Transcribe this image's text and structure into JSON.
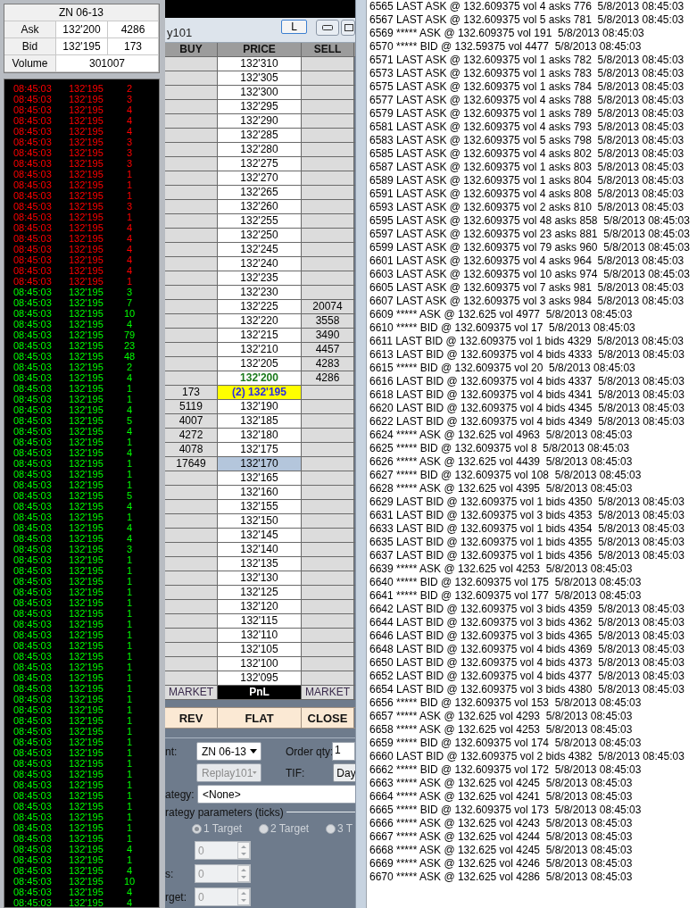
{
  "quote": {
    "title": "ZN 06-13",
    "rows": [
      {
        "label": "Ask",
        "price": "132'200",
        "size": "4286"
      },
      {
        "label": "Bid",
        "price": "132'195",
        "size": "173"
      }
    ],
    "volume_label": "Volume",
    "volume": "301007"
  },
  "tape": [
    {
      "time": "08:45:03",
      "price": "132'195",
      "qty": "2",
      "color": "#ff0000"
    },
    {
      "time": "08:45:03",
      "price": "132'195",
      "qty": "3",
      "color": "#ff0000"
    },
    {
      "time": "08:45:03",
      "price": "132'195",
      "qty": "4",
      "color": "#ff0000"
    },
    {
      "time": "08:45:03",
      "price": "132'195",
      "qty": "4",
      "color": "#ff0000"
    },
    {
      "time": "08:45:03",
      "price": "132'195",
      "qty": "4",
      "color": "#ff0000"
    },
    {
      "time": "08:45:03",
      "price": "132'195",
      "qty": "3",
      "color": "#ff0000"
    },
    {
      "time": "08:45:03",
      "price": "132'195",
      "qty": "3",
      "color": "#ff0000"
    },
    {
      "time": "08:45:03",
      "price": "132'195",
      "qty": "3",
      "color": "#ff0000"
    },
    {
      "time": "08:45:03",
      "price": "132'195",
      "qty": "1",
      "color": "#ff0000"
    },
    {
      "time": "08:45:03",
      "price": "132'195",
      "qty": "1",
      "color": "#ff0000"
    },
    {
      "time": "08:45:03",
      "price": "132'195",
      "qty": "1",
      "color": "#ff0000"
    },
    {
      "time": "08:45:03",
      "price": "132'195",
      "qty": "3",
      "color": "#ff0000"
    },
    {
      "time": "08:45:03",
      "price": "132'195",
      "qty": "1",
      "color": "#ff0000"
    },
    {
      "time": "08:45:03",
      "price": "132'195",
      "qty": "4",
      "color": "#ff0000"
    },
    {
      "time": "08:45:03",
      "price": "132'195",
      "qty": "4",
      "color": "#ff0000"
    },
    {
      "time": "08:45:03",
      "price": "132'195",
      "qty": "4",
      "color": "#ff0000"
    },
    {
      "time": "08:45:03",
      "price": "132'195",
      "qty": "4",
      "color": "#ff0000"
    },
    {
      "time": "08:45:03",
      "price": "132'195",
      "qty": "4",
      "color": "#ff0000"
    },
    {
      "time": "08:45:03",
      "price": "132'195",
      "qty": "1",
      "color": "#ff0000"
    },
    {
      "time": "08:45:03",
      "price": "132'195",
      "qty": "3",
      "color": "#00ff00"
    },
    {
      "time": "08:45:03",
      "price": "132'195",
      "qty": "7",
      "color": "#00ff00"
    },
    {
      "time": "08:45:03",
      "price": "132'195",
      "qty": "10",
      "color": "#00ff00"
    },
    {
      "time": "08:45:03",
      "price": "132'195",
      "qty": "4",
      "color": "#00ff00"
    },
    {
      "time": "08:45:03",
      "price": "132'195",
      "qty": "79",
      "color": "#00ff00"
    },
    {
      "time": "08:45:03",
      "price": "132'195",
      "qty": "23",
      "color": "#00ff00"
    },
    {
      "time": "08:45:03",
      "price": "132'195",
      "qty": "48",
      "color": "#00ff00"
    },
    {
      "time": "08:45:03",
      "price": "132'195",
      "qty": "2",
      "color": "#00ff00"
    },
    {
      "time": "08:45:03",
      "price": "132'195",
      "qty": "4",
      "color": "#00ff00"
    },
    {
      "time": "08:45:03",
      "price": "132'195",
      "qty": "1",
      "color": "#00ff00"
    },
    {
      "time": "08:45:03",
      "price": "132'195",
      "qty": "1",
      "color": "#00ff00"
    },
    {
      "time": "08:45:03",
      "price": "132'195",
      "qty": "4",
      "color": "#00ff00"
    },
    {
      "time": "08:45:03",
      "price": "132'195",
      "qty": "5",
      "color": "#00ff00"
    },
    {
      "time": "08:45:03",
      "price": "132'195",
      "qty": "4",
      "color": "#00ff00"
    },
    {
      "time": "08:45:03",
      "price": "132'195",
      "qty": "1",
      "color": "#00ff00"
    },
    {
      "time": "08:45:03",
      "price": "132'195",
      "qty": "4",
      "color": "#00ff00"
    },
    {
      "time": "08:45:03",
      "price": "132'195",
      "qty": "1",
      "color": "#00ff00"
    },
    {
      "time": "08:45:03",
      "price": "132'195",
      "qty": "1",
      "color": "#00ff00"
    },
    {
      "time": "08:45:03",
      "price": "132'195",
      "qty": "1",
      "color": "#00ff00"
    },
    {
      "time": "08:45:03",
      "price": "132'195",
      "qty": "5",
      "color": "#00ff00"
    },
    {
      "time": "08:45:03",
      "price": "132'195",
      "qty": "4",
      "color": "#00ff00"
    },
    {
      "time": "08:45:03",
      "price": "132'195",
      "qty": "1",
      "color": "#00ff00"
    },
    {
      "time": "08:45:03",
      "price": "132'195",
      "qty": "4",
      "color": "#00ff00"
    },
    {
      "time": "08:45:03",
      "price": "132'195",
      "qty": "4",
      "color": "#00ff00"
    },
    {
      "time": "08:45:03",
      "price": "132'195",
      "qty": "3",
      "color": "#00ff00"
    },
    {
      "time": "08:45:03",
      "price": "132'195",
      "qty": "1",
      "color": "#00ff00"
    },
    {
      "time": "08:45:03",
      "price": "132'195",
      "qty": "1",
      "color": "#00ff00"
    },
    {
      "time": "08:45:03",
      "price": "132'195",
      "qty": "1",
      "color": "#00ff00"
    },
    {
      "time": "08:45:03",
      "price": "132'195",
      "qty": "1",
      "color": "#00ff00"
    },
    {
      "time": "08:45:03",
      "price": "132'195",
      "qty": "1",
      "color": "#00ff00"
    },
    {
      "time": "08:45:03",
      "price": "132'195",
      "qty": "1",
      "color": "#00ff00"
    },
    {
      "time": "08:45:03",
      "price": "132'195",
      "qty": "1",
      "color": "#00ff00"
    },
    {
      "time": "08:45:03",
      "price": "132'195",
      "qty": "1",
      "color": "#00ff00"
    },
    {
      "time": "08:45:03",
      "price": "132'195",
      "qty": "1",
      "color": "#00ff00"
    },
    {
      "time": "08:45:03",
      "price": "132'195",
      "qty": "1",
      "color": "#00ff00"
    },
    {
      "time": "08:45:03",
      "price": "132'195",
      "qty": "1",
      "color": "#00ff00"
    },
    {
      "time": "08:45:03",
      "price": "132'195",
      "qty": "1",
      "color": "#00ff00"
    },
    {
      "time": "08:45:03",
      "price": "132'195",
      "qty": "1",
      "color": "#00ff00"
    },
    {
      "time": "08:45:03",
      "price": "132'195",
      "qty": "1",
      "color": "#00ff00"
    },
    {
      "time": "08:45:03",
      "price": "132'195",
      "qty": "1",
      "color": "#00ff00"
    },
    {
      "time": "08:45:03",
      "price": "132'195",
      "qty": "1",
      "color": "#00ff00"
    },
    {
      "time": "08:45:03",
      "price": "132'195",
      "qty": "1",
      "color": "#00ff00"
    },
    {
      "time": "08:45:03",
      "price": "132'195",
      "qty": "1",
      "color": "#00ff00"
    },
    {
      "time": "08:45:03",
      "price": "132'195",
      "qty": "1",
      "color": "#00ff00"
    },
    {
      "time": "08:45:03",
      "price": "132'195",
      "qty": "1",
      "color": "#00ff00"
    },
    {
      "time": "08:45:03",
      "price": "132'195",
      "qty": "1",
      "color": "#00ff00"
    },
    {
      "time": "08:45:03",
      "price": "132'195",
      "qty": "1",
      "color": "#00ff00"
    },
    {
      "time": "08:45:03",
      "price": "132'195",
      "qty": "1",
      "color": "#00ff00"
    },
    {
      "time": "08:45:03",
      "price": "132'195",
      "qty": "1",
      "color": "#00ff00"
    },
    {
      "time": "08:45:03",
      "price": "132'195",
      "qty": "1",
      "color": "#00ff00"
    },
    {
      "time": "08:45:03",
      "price": "132'195",
      "qty": "1",
      "color": "#00ff00"
    },
    {
      "time": "08:45:03",
      "price": "132'195",
      "qty": "1",
      "color": "#00ff00"
    },
    {
      "time": "08:45:03",
      "price": "132'195",
      "qty": "4",
      "color": "#00ff00"
    },
    {
      "time": "08:45:03",
      "price": "132'195",
      "qty": "1",
      "color": "#00ff00"
    },
    {
      "time": "08:45:03",
      "price": "132'195",
      "qty": "4",
      "color": "#00ff00"
    },
    {
      "time": "08:45:03",
      "price": "132'195",
      "qty": "10",
      "color": "#00ff00"
    },
    {
      "time": "08:45:03",
      "price": "132'195",
      "qty": "4",
      "color": "#00ff00"
    },
    {
      "time": "08:45:03",
      "price": "132'195",
      "qty": "4",
      "color": "#00ff00"
    }
  ],
  "dom": {
    "title": "y101",
    "lock_button": "L",
    "columns": [
      "BUY",
      "PRICE",
      "SELL"
    ],
    "rows": [
      {
        "price": "132'310",
        "kind": "plain"
      },
      {
        "price": "132'305",
        "kind": "plain"
      },
      {
        "price": "132'300",
        "kind": "plain"
      },
      {
        "price": "132'295",
        "kind": "plain"
      },
      {
        "price": "132'290",
        "kind": "plain"
      },
      {
        "price": "132'285",
        "kind": "plain"
      },
      {
        "price": "132'280",
        "kind": "plain"
      },
      {
        "price": "132'275",
        "kind": "plain"
      },
      {
        "price": "132'270",
        "kind": "plain"
      },
      {
        "price": "132'265",
        "kind": "plain"
      },
      {
        "price": "132'260",
        "kind": "plain"
      },
      {
        "price": "132'255",
        "kind": "plain"
      },
      {
        "price": "132'250",
        "kind": "plain"
      },
      {
        "price": "132'245",
        "kind": "plain"
      },
      {
        "price": "132'240",
        "kind": "plain"
      },
      {
        "price": "132'235",
        "kind": "plain"
      },
      {
        "price": "132'230",
        "kind": "plain"
      },
      {
        "price": "132'225",
        "sell": "20074",
        "kind": "plain"
      },
      {
        "price": "132'220",
        "sell": "3558",
        "kind": "plain"
      },
      {
        "price": "132'215",
        "sell": "3490",
        "kind": "plain"
      },
      {
        "price": "132'210",
        "sell": "4457",
        "kind": "plain"
      },
      {
        "price": "132'205",
        "sell": "4283",
        "kind": "plain"
      },
      {
        "price": "132'200",
        "sell": "4286",
        "kind": "best_ask"
      },
      {
        "buy": "173",
        "price": "(2) 132'195",
        "kind": "last"
      },
      {
        "buy": "5119",
        "price": "132'190",
        "kind": "plain"
      },
      {
        "buy": "4007",
        "price": "132'185",
        "kind": "plain"
      },
      {
        "buy": "4272",
        "price": "132'180",
        "kind": "plain"
      },
      {
        "buy": "4078",
        "price": "132'175",
        "kind": "plain"
      },
      {
        "buy": "17649",
        "price": "132'170",
        "kind": "cursor"
      },
      {
        "price": "132'165",
        "kind": "plain"
      },
      {
        "price": "132'160",
        "kind": "plain"
      },
      {
        "price": "132'155",
        "kind": "plain"
      },
      {
        "price": "132'150",
        "kind": "plain"
      },
      {
        "price": "132'145",
        "kind": "plain"
      },
      {
        "price": "132'140",
        "kind": "plain"
      },
      {
        "price": "132'135",
        "kind": "plain"
      },
      {
        "price": "132'130",
        "kind": "plain"
      },
      {
        "price": "132'125",
        "kind": "plain"
      },
      {
        "price": "132'120",
        "kind": "plain"
      },
      {
        "price": "132'115",
        "kind": "plain"
      },
      {
        "price": "132'110",
        "kind": "plain"
      },
      {
        "price": "132'105",
        "kind": "plain"
      },
      {
        "price": "132'100",
        "kind": "plain"
      },
      {
        "price": "132'095",
        "kind": "plain"
      }
    ],
    "footer": [
      "MARKET",
      "PnL",
      "MARKET"
    ],
    "actions": [
      "REV",
      "FLAT",
      "CLOSE"
    ]
  },
  "order_form": {
    "instrument": {
      "label": "nt:",
      "value": "ZN 06-13",
      "disabled": false
    },
    "order_qty": {
      "label": "Order qty:",
      "value": "1"
    },
    "account": {
      "value": "Replay101",
      "disabled": true
    },
    "tif": {
      "label": "TIF:",
      "value": "Day"
    },
    "strategy": {
      "label": "ategy:",
      "value": "<None>"
    },
    "parameters_label": "rategy parameters (ticks)",
    "targets": [
      {
        "label": "1 Target",
        "selected": true
      },
      {
        "label": "2 Target",
        "selected": false
      },
      {
        "label": "3 T",
        "selected": false
      }
    ],
    "spinners": [
      {
        "value": "0",
        "disabled": true
      },
      {
        "label": "s:",
        "value": "0",
        "disabled": true
      },
      {
        "label": "rget:",
        "value": "0",
        "disabled": true
      }
    ]
  },
  "log": [
    "6565 LAST ASK @ 132.609375 vol 4 asks 776  5/8/2013 08:45:03",
    "6567 LAST ASK @ 132.609375 vol 5 asks 781  5/8/2013 08:45:03",
    "6569 ***** ASK @ 132.609375 vol 191  5/8/2013 08:45:03",
    "6570 ***** BID @ 132.59375 vol 4477  5/8/2013 08:45:03",
    "6571 LAST ASK @ 132.609375 vol 1 asks 782  5/8/2013 08:45:03",
    "6573 LAST ASK @ 132.609375 vol 1 asks 783  5/8/2013 08:45:03",
    "6575 LAST ASK @ 132.609375 vol 1 asks 784  5/8/2013 08:45:03",
    "6577 LAST ASK @ 132.609375 vol 4 asks 788  5/8/2013 08:45:03",
    "6579 LAST ASK @ 132.609375 vol 1 asks 789  5/8/2013 08:45:03",
    "6581 LAST ASK @ 132.609375 vol 4 asks 793  5/8/2013 08:45:03",
    "6583 LAST ASK @ 132.609375 vol 5 asks 798  5/8/2013 08:45:03",
    "6585 LAST ASK @ 132.609375 vol 4 asks 802  5/8/2013 08:45:03",
    "6587 LAST ASK @ 132.609375 vol 1 asks 803  5/8/2013 08:45:03",
    "6589 LAST ASK @ 132.609375 vol 1 asks 804  5/8/2013 08:45:03",
    "6591 LAST ASK @ 132.609375 vol 4 asks 808  5/8/2013 08:45:03",
    "6593 LAST ASK @ 132.609375 vol 2 asks 810  5/8/2013 08:45:03",
    "6595 LAST ASK @ 132.609375 vol 48 asks 858  5/8/2013 08:45:03",
    "6597 LAST ASK @ 132.609375 vol 23 asks 881  5/8/2013 08:45:03",
    "6599 LAST ASK @ 132.609375 vol 79 asks 960  5/8/2013 08:45:03",
    "6601 LAST ASK @ 132.609375 vol 4 asks 964  5/8/2013 08:45:03",
    "6603 LAST ASK @ 132.609375 vol 10 asks 974  5/8/2013 08:45:03",
    "6605 LAST ASK @ 132.609375 vol 7 asks 981  5/8/2013 08:45:03",
    "6607 LAST ASK @ 132.609375 vol 3 asks 984  5/8/2013 08:45:03",
    "6609 ***** ASK @ 132.625 vol 4977  5/8/2013 08:45:03",
    "6610 ***** BID @ 132.609375 vol 17  5/8/2013 08:45:03",
    "6611 LAST BID @ 132.609375 vol 1 bids 4329  5/8/2013 08:45:03",
    "6613 LAST BID @ 132.609375 vol 4 bids 4333  5/8/2013 08:45:03",
    "6615 ***** BID @ 132.609375 vol 20  5/8/2013 08:45:03",
    "6616 LAST BID @ 132.609375 vol 4 bids 4337  5/8/2013 08:45:03",
    "6618 LAST BID @ 132.609375 vol 4 bids 4341  5/8/2013 08:45:03",
    "6620 LAST BID @ 132.609375 vol 4 bids 4345  5/8/2013 08:45:03",
    "6622 LAST BID @ 132.609375 vol 4 bids 4349  5/8/2013 08:45:03",
    "6624 ***** ASK @ 132.625 vol 4963  5/8/2013 08:45:03",
    "6625 ***** BID @ 132.609375 vol 8  5/8/2013 08:45:03",
    "6626 ***** ASK @ 132.625 vol 4439  5/8/2013 08:45:03",
    "6627 ***** BID @ 132.609375 vol 108  5/8/2013 08:45:03",
    "6628 ***** ASK @ 132.625 vol 4395  5/8/2013 08:45:03",
    "6629 LAST BID @ 132.609375 vol 1 bids 4350  5/8/2013 08:45:03",
    "6631 LAST BID @ 132.609375 vol 3 bids 4353  5/8/2013 08:45:03",
    "6633 LAST BID @ 132.609375 vol 1 bids 4354  5/8/2013 08:45:03",
    "6635 LAST BID @ 132.609375 vol 1 bids 4355  5/8/2013 08:45:03",
    "6637 LAST BID @ 132.609375 vol 1 bids 4356  5/8/2013 08:45:03",
    "6639 ***** ASK @ 132.625 vol 4253  5/8/2013 08:45:03",
    "6640 ***** BID @ 132.609375 vol 175  5/8/2013 08:45:03",
    "6641 ***** BID @ 132.609375 vol 177  5/8/2013 08:45:03",
    "6642 LAST BID @ 132.609375 vol 3 bids 4359  5/8/2013 08:45:03",
    "6644 LAST BID @ 132.609375 vol 3 bids 4362  5/8/2013 08:45:03",
    "6646 LAST BID @ 132.609375 vol 3 bids 4365  5/8/2013 08:45:03",
    "6648 LAST BID @ 132.609375 vol 4 bids 4369  5/8/2013 08:45:03",
    "6650 LAST BID @ 132.609375 vol 4 bids 4373  5/8/2013 08:45:03",
    "6652 LAST BID @ 132.609375 vol 4 bids 4377  5/8/2013 08:45:03",
    "6654 LAST BID @ 132.609375 vol 3 bids 4380  5/8/2013 08:45:03",
    "6656 ***** BID @ 132.609375 vol 153  5/8/2013 08:45:03",
    "6657 ***** ASK @ 132.625 vol 4293  5/8/2013 08:45:03",
    "6658 ***** ASK @ 132.625 vol 4253  5/8/2013 08:45:03",
    "6659 ***** BID @ 132.609375 vol 174  5/8/2013 08:45:03",
    "6660 LAST BID @ 132.609375 vol 2 bids 4382  5/8/2013 08:45:03",
    "6662 ***** BID @ 132.609375 vol 172  5/8/2013 08:45:03",
    "6663 ***** ASK @ 132.625 vol 4245  5/8/2013 08:45:03",
    "6664 ***** ASK @ 132.625 vol 4241  5/8/2013 08:45:03",
    "6665 ***** BID @ 132.609375 vol 173  5/8/2013 08:45:03",
    "6666 ***** ASK @ 132.625 vol 4243  5/8/2013 08:45:03",
    "6667 ***** ASK @ 132.625 vol 4244  5/8/2013 08:45:03",
    "6668 ***** ASK @ 132.625 vol 4245  5/8/2013 08:45:03",
    "6669 ***** ASK @ 132.625 vol 4246  5/8/2013 08:45:03",
    "6670 ***** ASK @ 132.625 vol 4286  5/8/2013 08:45:03"
  ]
}
